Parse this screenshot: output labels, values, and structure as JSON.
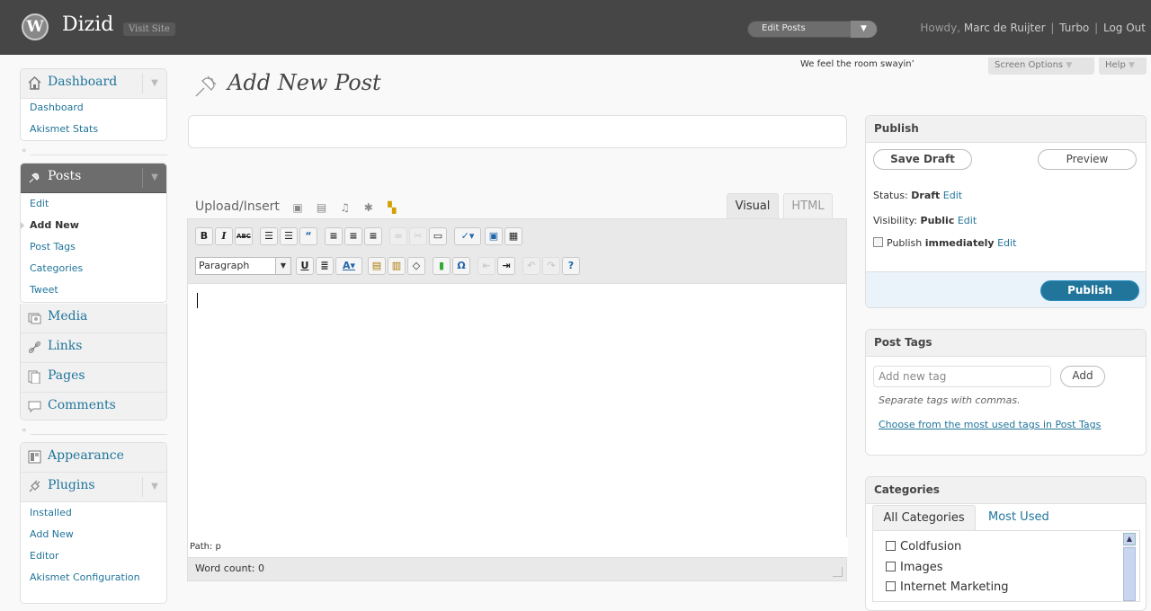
{
  "header": {
    "logo": "W",
    "site_title": "Dizid",
    "visit_site": "Visit Site",
    "favorite_action": "Edit Posts",
    "howdy": "Howdy, ",
    "user_name": "Marc de Ruijter",
    "sep": "|",
    "turbo": "Turbo",
    "logout": "Log Out"
  },
  "quote": "We feel the room swayin’",
  "screen_options": "Screen Options",
  "help": "Help",
  "menu": {
    "dashboard": {
      "label": "Dashboard",
      "items": [
        "Dashboard",
        "Akismet Stats"
      ]
    },
    "posts": {
      "label": "Posts",
      "items": [
        "Edit",
        "Add New",
        "Post Tags",
        "Categories",
        "Tweet"
      ]
    },
    "media": "Media",
    "links": "Links",
    "pages": "Pages",
    "comments": "Comments",
    "appearance": "Appearance",
    "plugins": {
      "label": "Plugins",
      "items": [
        "Installed",
        "Add New",
        "Editor",
        "Akismet Configuration"
      ]
    }
  },
  "page_title": "Add New Post",
  "editor": {
    "upload_insert": "Upload/Insert",
    "tab_visual": "Visual",
    "tab_html": "HTML",
    "format_select": "Paragraph",
    "path": "Path: p",
    "word_count": "Word count: 0"
  },
  "publish": {
    "title": "Publish",
    "save_draft": "Save Draft",
    "preview": "Preview",
    "status_label": "Status: ",
    "status_value": "Draft",
    "visibility_label": "Visibility: ",
    "visibility_value": "Public",
    "publish_label": "Publish ",
    "publish_value": "immediately",
    "edit": "Edit",
    "publish_button": "Publish"
  },
  "tags": {
    "title": "Post Tags",
    "placeholder": "Add new tag",
    "add": "Add",
    "hint": "Separate tags with commas.",
    "choose": "Choose from the most used tags in Post Tags"
  },
  "categories": {
    "title": "Categories",
    "tab_all": "All Categories",
    "tab_most": "Most Used",
    "items": [
      "Coldfusion",
      "Images",
      "Internet Marketing"
    ]
  }
}
